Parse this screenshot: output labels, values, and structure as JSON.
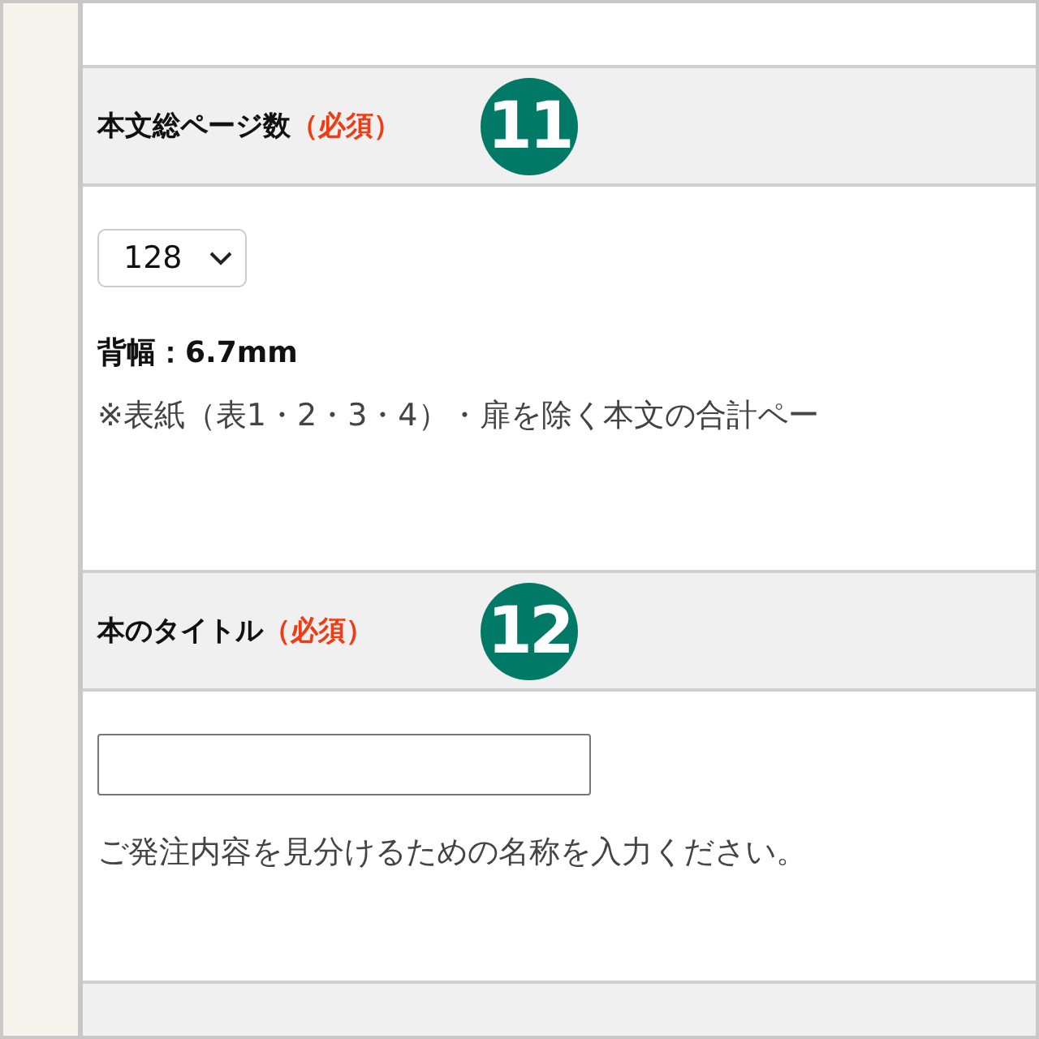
{
  "sections": [
    {
      "title": "本文総ページ数",
      "required": "（必須）",
      "badge": "11",
      "items": [
        {
          "kind": "select",
          "value": "128"
        },
        {
          "kind": "strong",
          "text": "背幅：6.7mm"
        },
        {
          "kind": "note",
          "text": "※表紙（表1・2・3・4）・扉を除く本文の合計ペー"
        }
      ]
    },
    {
      "title": "本のタイトル",
      "required": "（必須）",
      "badge": "12",
      "items": [
        {
          "kind": "input"
        },
        {
          "kind": "note",
          "text": "ご発注内容を見分けるための名称を入力ください。"
        }
      ]
    }
  ]
}
